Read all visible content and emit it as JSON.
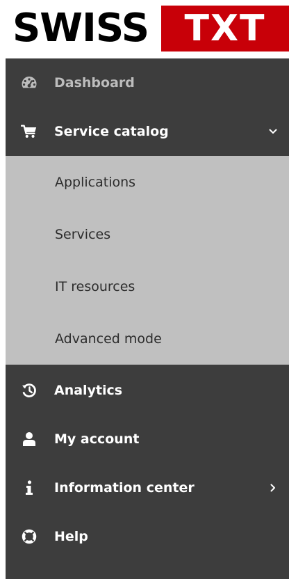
{
  "logo": {
    "left_text": "SWISS",
    "right_text": "TXT",
    "colors": {
      "left_bg": "#ffffff",
      "left_fg": "#000000",
      "right_bg": "#c80008",
      "right_fg": "#ffffff"
    }
  },
  "sidebar": {
    "background": "#3d3d3d",
    "items": [
      {
        "label": "Dashboard",
        "icon": "dashboard-gauge-icon",
        "state": "muted"
      },
      {
        "label": "Service catalog",
        "icon": "shopping-cart-icon",
        "state": "expanded",
        "chevron": "chevron-down-icon"
      },
      {
        "label": "Analytics",
        "icon": "history-icon"
      },
      {
        "label": "My account",
        "icon": "user-icon"
      },
      {
        "label": "Information center",
        "icon": "info-icon",
        "chevron": "chevron-right-icon"
      },
      {
        "label": "Help",
        "icon": "life-ring-icon"
      }
    ],
    "submenu": {
      "background": "#c0c0c0",
      "items": [
        {
          "label": "Applications"
        },
        {
          "label": "Services"
        },
        {
          "label": "IT resources"
        },
        {
          "label": "Advanced mode"
        }
      ]
    }
  }
}
